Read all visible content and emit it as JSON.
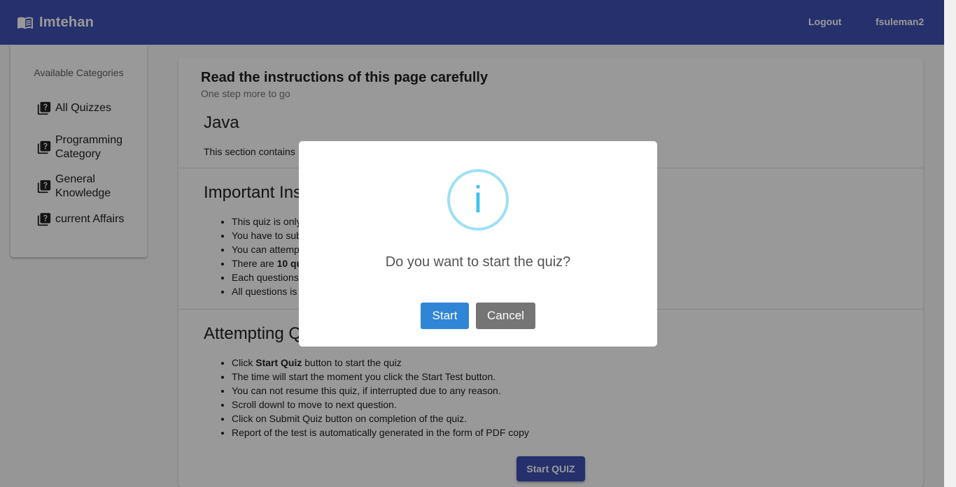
{
  "header": {
    "brand_title": "Imtehan",
    "logout_label": "Logout",
    "username": "fsuleman2",
    "color": "#3f51b5"
  },
  "sidebar": {
    "heading": "Available Categories",
    "items": [
      {
        "label": "All Quizzes"
      },
      {
        "label": "Programming Category"
      },
      {
        "label": "General Knowledge"
      },
      {
        "label": "current Affairs"
      }
    ]
  },
  "main": {
    "title": "Read the instructions of this page carefully",
    "subtitle": "One step more to go",
    "quiz_title": "Java",
    "quiz_description": "This section contains",
    "important_heading": "Important Ins",
    "important_items": [
      {
        "text": "This quiz is only"
      },
      {
        "text": "You have to sub"
      },
      {
        "text": "You can attemp"
      },
      {
        "prefix": "There are ",
        "bold": "10 qu",
        "suffix": ""
      },
      {
        "text": "Each questions"
      },
      {
        "text": "All questions is"
      }
    ],
    "attempting_heading": "Attempting Q",
    "attempting_items": [
      {
        "prefix": "Click ",
        "bold": "Start Quiz",
        "suffix": " button to start the quiz"
      },
      {
        "text": "The time will start the moment you click the Start Test button."
      },
      {
        "text": "You can not resume this quiz, if interrupted due to any reason."
      },
      {
        "text": "Scroll downl to move to next question."
      },
      {
        "text": "Click on Submit Quiz button on completion of the quiz."
      },
      {
        "text": "Report of the test is automatically generated in the form of PDF copy"
      }
    ],
    "start_quiz_label": "Start QUIZ"
  },
  "dialog": {
    "icon": "info-icon",
    "icon_glyph": "i",
    "question": "Do you want to start the quiz?",
    "confirm_label": "Start",
    "cancel_label": "Cancel",
    "confirm_color": "#3085d6",
    "cancel_color": "#757575"
  }
}
